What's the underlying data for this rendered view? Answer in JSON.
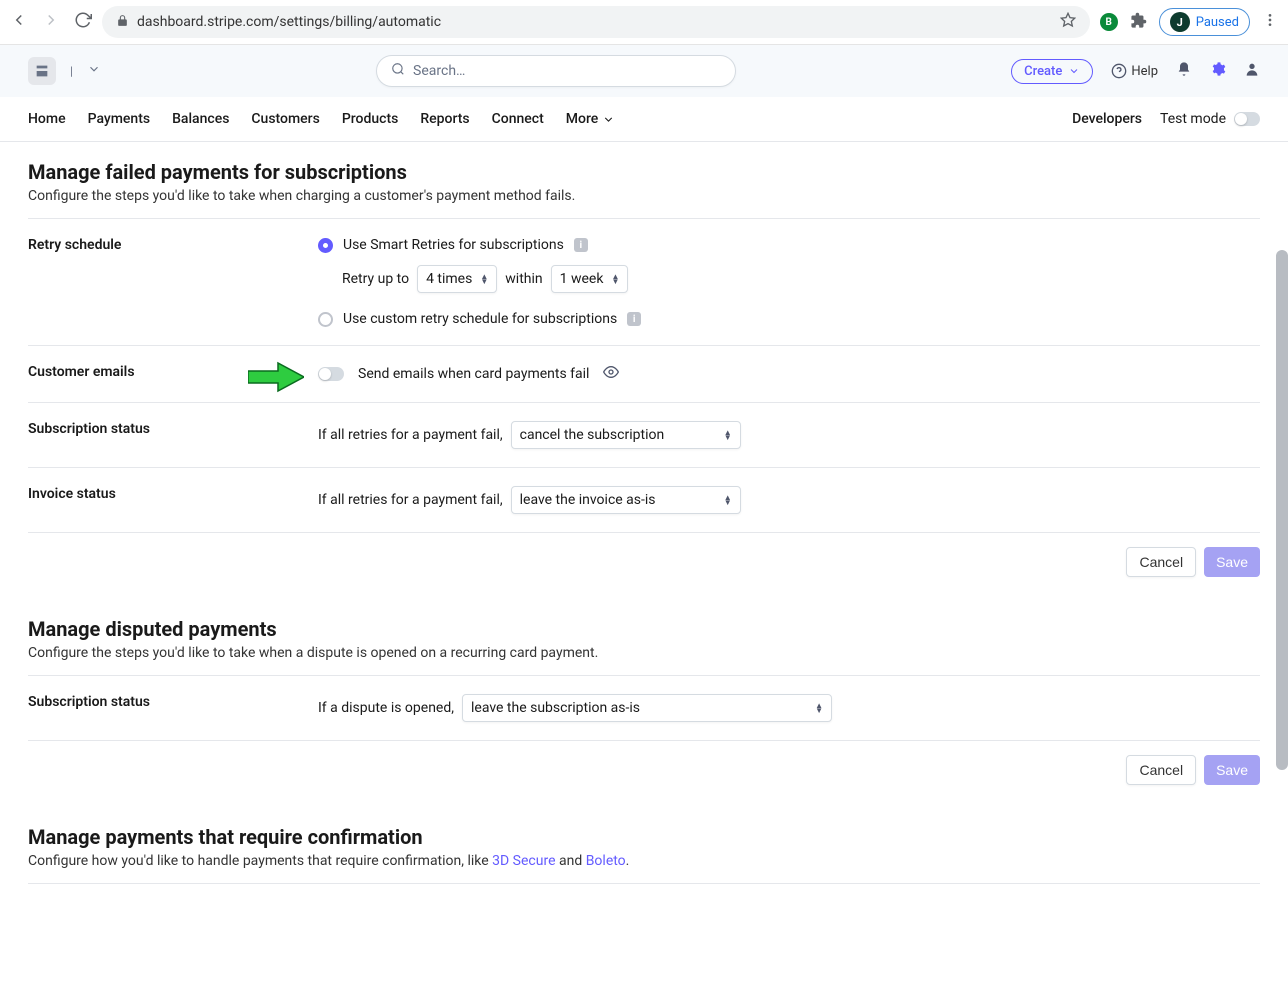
{
  "browser": {
    "url": "dashboard.stripe.com/settings/billing/automatic",
    "paused_label": "Paused",
    "avatar_letter": "J",
    "ext_badge": "B"
  },
  "header": {
    "search_placeholder": "Search…",
    "create_label": "Create",
    "help_label": "Help"
  },
  "nav": {
    "items": [
      "Home",
      "Payments",
      "Balances",
      "Customers",
      "Products",
      "Reports",
      "Connect",
      "More"
    ],
    "developers": "Developers",
    "test_mode": "Test mode"
  },
  "section_failed": {
    "title": "Manage failed payments for subscriptions",
    "subtitle": "Configure the steps you'd like to take when charging a customer's payment method fails."
  },
  "retry": {
    "label": "Retry schedule",
    "smart_label": "Use Smart Retries for subscriptions",
    "retry_up_to": "Retry up to",
    "times_value": "4 times",
    "within": "within",
    "week_value": "1 week",
    "custom_label": "Use custom retry schedule for subscriptions"
  },
  "emails": {
    "label": "Customer emails",
    "toggle_label": "Send emails when card payments fail"
  },
  "sub_status": {
    "label": "Subscription status",
    "prefix": "If all retries for a payment fail,",
    "value": "cancel the subscription"
  },
  "inv_status": {
    "label": "Invoice status",
    "prefix": "If all retries for a payment fail,",
    "value": "leave the invoice as-is"
  },
  "buttons": {
    "cancel": "Cancel",
    "save": "Save"
  },
  "section_disputed": {
    "title": "Manage disputed payments",
    "subtitle": "Configure the steps you'd like to take when a dispute is opened on a recurring card payment."
  },
  "dispute_sub": {
    "label": "Subscription status",
    "prefix": "If a dispute is opened,",
    "value": "leave the subscription as-is"
  },
  "section_confirm": {
    "title": "Manage payments that require confirmation",
    "subtitle_pre": "Configure how you'd like to handle payments that require confirmation, like ",
    "link1": "3D Secure",
    "and": " and ",
    "link2": "Boleto",
    "period": "."
  }
}
